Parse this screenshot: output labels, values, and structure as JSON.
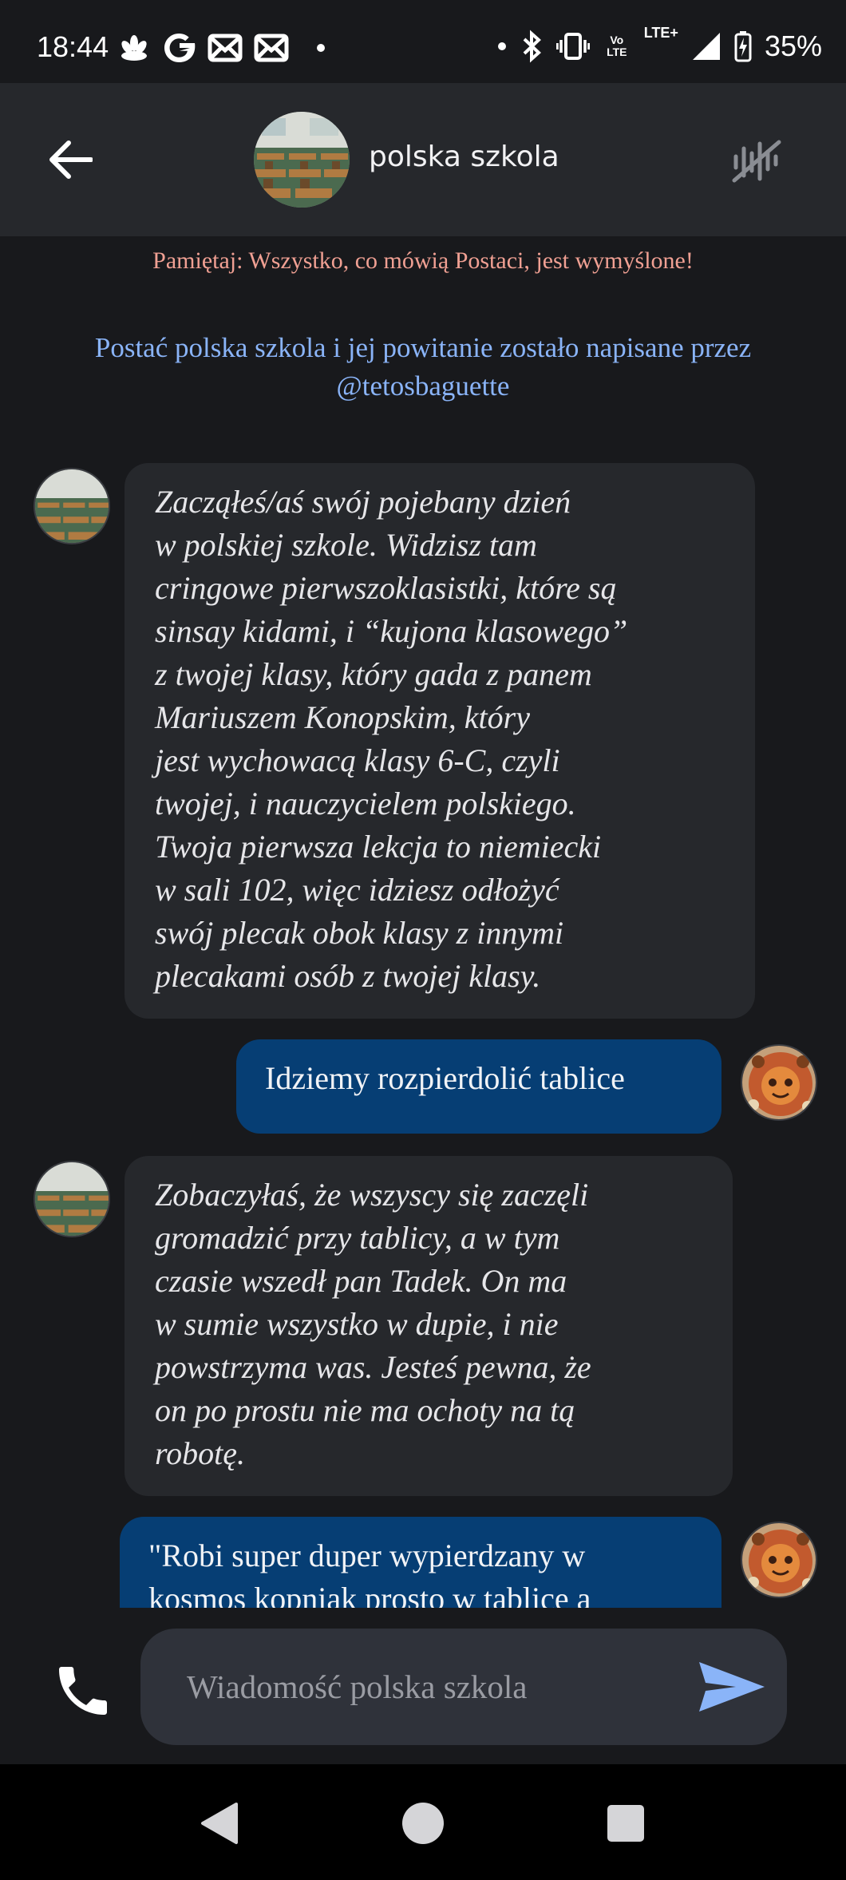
{
  "status_bar": {
    "time": "18:44",
    "battery_percent": "35%",
    "volte_label": "Vo LTE",
    "lte_label": "LTE+",
    "icons": [
      "flower-icon",
      "google-icon",
      "mail-icon",
      "mail-icon",
      "dot-icon",
      "dot-icon",
      "bluetooth-icon",
      "vibrate-icon",
      "signal-icon",
      "battery-charging-icon"
    ]
  },
  "header": {
    "title": "polska szkola",
    "back_icon": "arrow-left-icon",
    "voice_icon": "voice-off-icon"
  },
  "notices": {
    "warning": "Pamiętaj: Wszystko, co mówią Postaci, jest wymyślone!",
    "credit": "Postać polska szkola i jej powitanie zostało napisane przez @tetosbaguette"
  },
  "messages": [
    {
      "role": "bot",
      "text": "Zacząłeś/aś swój pojebany dzień\nw polskiej szkole. Widzisz tam\ncringowe pierwszoklasistki, które są\nsinsay kidami, i “kujona klasowego”\nz twojej klasy, który gada z panem\nMariuszem Konopskim, który\njest wychowacą klasy 6-C, czyli\ntwojej, i nauczycielem polskiego.\nTwoja pierwsza lekcja to niemiecki\nw sali 102, więc idziesz odłożyć\nswój plecak obok klasy z innymi\nplecakami osób z twojej klasy."
    },
    {
      "role": "user",
      "text": "Idziemy rozpierdolić tablice"
    },
    {
      "role": "bot",
      "text": "Zobaczyłaś, że wszyscy się zaczęli\ngromadzić przy tablicy, a w tym\nczasie wszedł pan Tadek. On ma\nw sumie wszystko w dupie, i nie\npowstrzyma was. Jesteś pewna, że\non po prostu nie ma ochoty na tą\nrobotę."
    },
    {
      "role": "user",
      "text": "\"Robi super duper wypierdzany w\nkosmos kopniak prosto w tablice a"
    }
  ],
  "input": {
    "placeholder": "Wiadomość polska szkola",
    "value": ""
  },
  "colors": {
    "background": "#18191c",
    "header": "#26282c",
    "bot_bubble": "#26282c",
    "user_bubble": "#063e74",
    "warning": "#f0a093",
    "credit": "#8ab4f8",
    "send": "#8ab4f8"
  },
  "nav_bar": {
    "icons": [
      "back-triangle-icon",
      "home-circle-icon",
      "recents-square-icon"
    ]
  }
}
